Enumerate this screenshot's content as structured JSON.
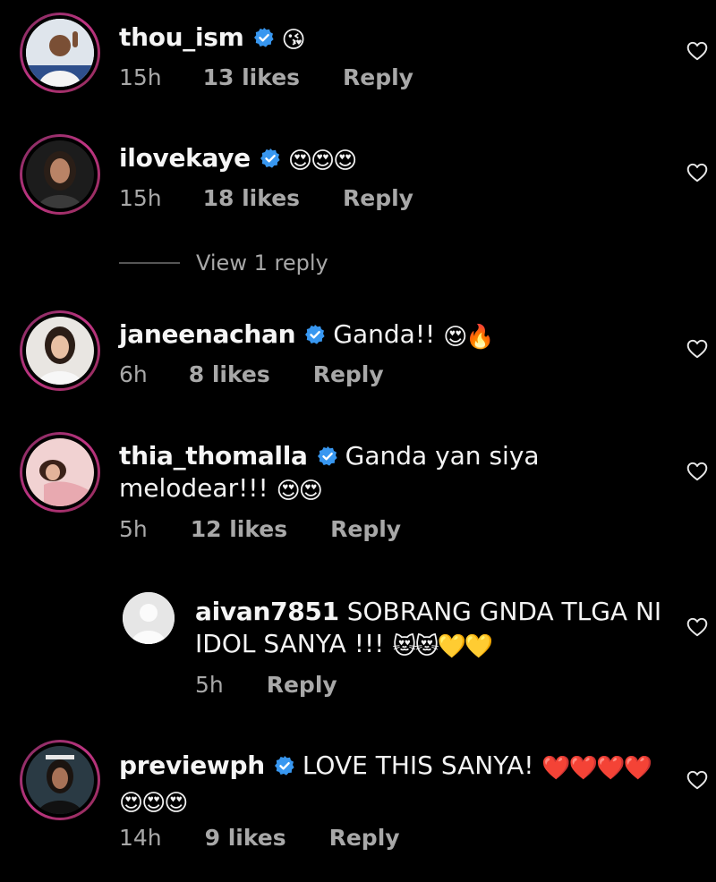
{
  "comments": [
    {
      "username": "thou_ism",
      "text": "",
      "emoji": "😘",
      "time": "15h",
      "likes": "13 likes",
      "reply": "Reply",
      "avatar": "avatar-photo"
    },
    {
      "username": "ilovekaye",
      "text": "",
      "emoji": "😍😍😍",
      "time": "15h",
      "likes": "18 likes",
      "reply": "Reply",
      "avatar": "avatar-photo"
    },
    {
      "username": "janeenachan",
      "text": "Ganda!!",
      "emoji": "😍🔥",
      "time": "6h",
      "likes": "8 likes",
      "reply": "Reply",
      "avatar": "avatar-photo"
    },
    {
      "username": "thia_thomalla",
      "text": "Ganda yan siya",
      "text2": "melodear!!!",
      "emoji": "😍😍",
      "time": "5h",
      "likes": "12 likes",
      "reply": "Reply",
      "avatar": "avatar-photo"
    },
    {
      "username": "aivan7851",
      "text": "SOBRANG GNDA TLGA NI",
      "text2": "IDOL SANYA !!!",
      "emoji": "😻😻💛💛",
      "time": "5h",
      "reply": "Reply",
      "avatar": "default-avatar"
    },
    {
      "username": "previewph",
      "text": "LOVE THIS SANYA!",
      "emoji": "❤️❤️❤️❤️",
      "emoji2": "😍😍😍",
      "time": "14h",
      "likes": "9 likes",
      "reply": "Reply",
      "avatar": "avatar-photo"
    }
  ],
  "view_replies": "View 1 reply",
  "colors": {
    "background": "#000000",
    "text": "#f5f5f5",
    "muted": "#a8a8a8",
    "verified": "#3897f0",
    "ring": "#c13584"
  }
}
